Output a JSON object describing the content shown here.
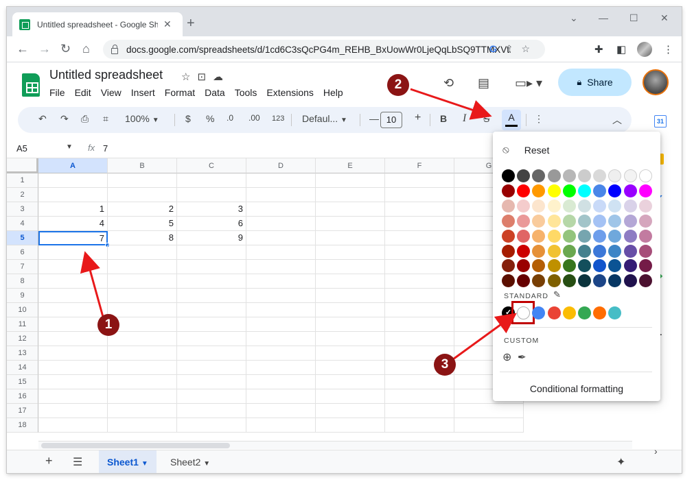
{
  "browser": {
    "tab_title": "Untitled spreadsheet - Google Sh",
    "url": "docs.google.com/spreadsheets/d/1cd6C3sQcPG4m_REHB_BxUowWr0LjeQqLbSQ9TTMXVt...",
    "icons": [
      "back-icon",
      "forward-icon",
      "reload-icon",
      "home-icon",
      "google-lens-icon",
      "share-page-icon",
      "bookmark-star-icon",
      "extensions-icon",
      "sidepanel-icon",
      "profile-avatar",
      "more-vert-icon"
    ]
  },
  "doc": {
    "title": "Untitled spreadsheet",
    "menu": [
      "File",
      "Edit",
      "View",
      "Insert",
      "Format",
      "Data",
      "Tools",
      "Extensions",
      "Help"
    ],
    "share_label": "Share"
  },
  "toolbar": {
    "zoom": "100%",
    "currency": "$",
    "percent": "%",
    "decrease_decimal": ".0",
    "increase_decimal": ".00",
    "number_format": "123",
    "font": "Defaul...",
    "font_size": "10",
    "bold": "B",
    "italic": "I",
    "strike": "S",
    "text_color": "A"
  },
  "formula_bar": {
    "cell_ref": "A5",
    "fx": "fx",
    "value": "7"
  },
  "grid": {
    "columns": [
      "A",
      "B",
      "C",
      "D",
      "E",
      "F",
      "G"
    ],
    "rows": [
      "1",
      "2",
      "3",
      "4",
      "5",
      "6",
      "7",
      "8",
      "9",
      "10",
      "11",
      "12",
      "13",
      "14",
      "15",
      "16",
      "17",
      "18"
    ],
    "cells": {
      "r3": [
        "1",
        "2",
        "3"
      ],
      "r4": [
        "4",
        "5",
        "6"
      ],
      "r5": [
        "7",
        "8",
        "9"
      ]
    },
    "selected_cell": "A5"
  },
  "sheets": {
    "tabs": [
      "Sheet1",
      "Sheet2"
    ],
    "active": "Sheet1"
  },
  "color_menu": {
    "reset_label": "Reset",
    "standard_label": "STANDARD",
    "custom_label": "CUSTOM",
    "conditional_label": "Conditional formatting",
    "palette": [
      [
        "#000000",
        "#434343",
        "#666666",
        "#999999",
        "#b7b7b7",
        "#cccccc",
        "#d9d9d9",
        "#efefef",
        "#f3f3f3",
        "#ffffff"
      ],
      [
        "#980000",
        "#ff0000",
        "#ff9900",
        "#ffff00",
        "#00ff00",
        "#00ffff",
        "#4a86e8",
        "#0000ff",
        "#9900ff",
        "#ff00ff"
      ],
      [
        "#e6b8af",
        "#f4cccc",
        "#fce5cd",
        "#fff2cc",
        "#d9ead3",
        "#d0e0e3",
        "#c9daf8",
        "#cfe2f3",
        "#d9d2e9",
        "#ead1dc"
      ],
      [
        "#dd7e6b",
        "#ea9999",
        "#f9cb9c",
        "#ffe599",
        "#b6d7a8",
        "#a2c4c9",
        "#a4c2f4",
        "#9fc5e8",
        "#b4a7d6",
        "#d5a6bd"
      ],
      [
        "#cc4125",
        "#e06666",
        "#f6b26b",
        "#ffd966",
        "#93c47d",
        "#76a5af",
        "#6d9eeb",
        "#6fa8dc",
        "#8e7cc3",
        "#c27ba0"
      ],
      [
        "#a61c00",
        "#cc0000",
        "#e69138",
        "#f1c232",
        "#6aa84f",
        "#45818e",
        "#3c78d8",
        "#3d85c6",
        "#674ea7",
        "#a64d79"
      ],
      [
        "#85200c",
        "#990000",
        "#b45f06",
        "#bf9000",
        "#38761d",
        "#134f5c",
        "#1155cc",
        "#0b5394",
        "#351c75",
        "#741b47"
      ],
      [
        "#5b0f00",
        "#660000",
        "#783f04",
        "#7f6000",
        "#274e13",
        "#0c343d",
        "#1c4587",
        "#073763",
        "#20124d",
        "#4c1130"
      ]
    ],
    "standard": [
      "#000000",
      "#ffffff",
      "#4285f4",
      "#ea4335",
      "#fbbc04",
      "#34a853",
      "#ff6d01",
      "#46bdc6"
    ]
  },
  "annotations": {
    "step1": "1",
    "step2": "2",
    "step3": "3",
    "color": "#e8191a"
  }
}
